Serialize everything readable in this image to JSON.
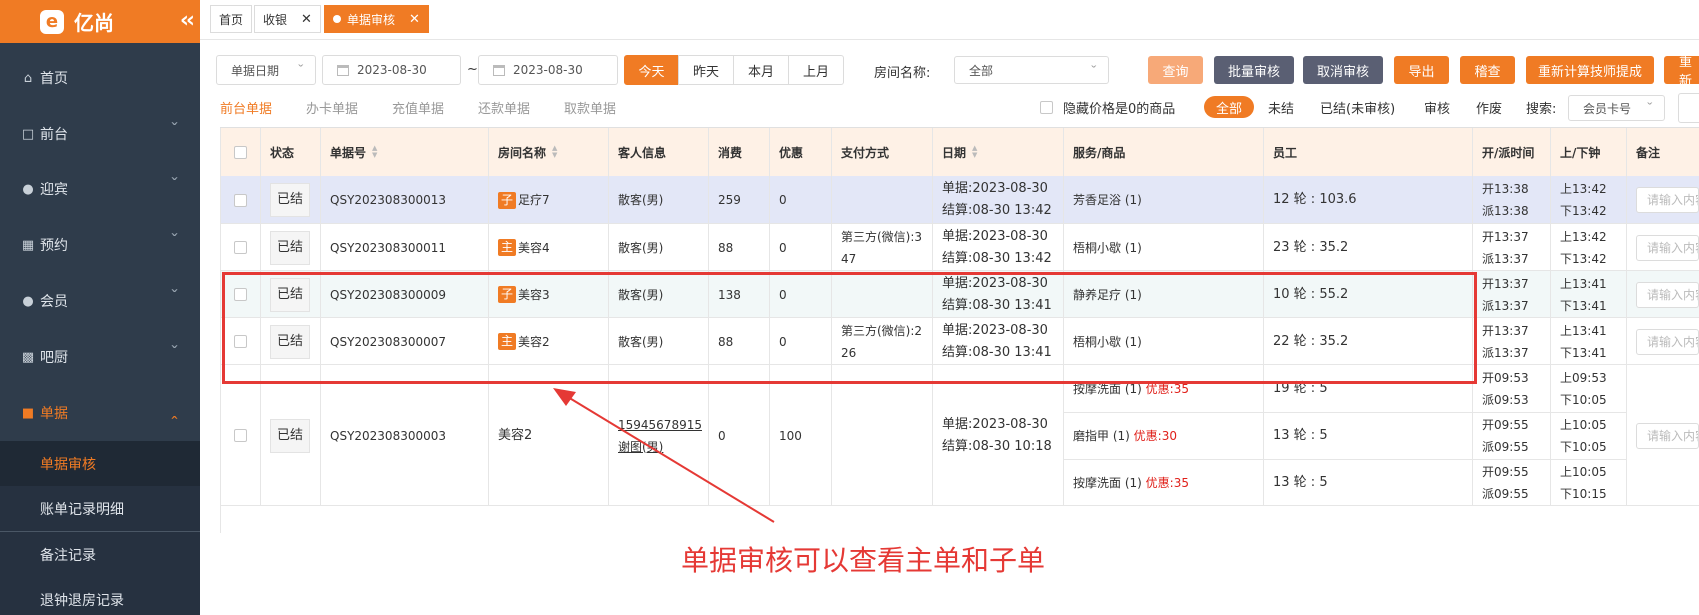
{
  "brand": {
    "name": "亿尚",
    "logo_mark": "e"
  },
  "colors": {
    "accent": "#f07b24",
    "sidebar": "#2f3c4b",
    "annotation": "#e53935",
    "highlight_row": "#e3e7f7"
  },
  "sidebar": {
    "items": [
      {
        "label": "首页",
        "icon": "home-icon"
      },
      {
        "label": "前台",
        "icon": "monitor-icon"
      },
      {
        "label": "迎宾",
        "icon": "user-plus-icon"
      },
      {
        "label": "预约",
        "icon": "calendar-icon"
      },
      {
        "label": "会员",
        "icon": "user-icon"
      },
      {
        "label": "吧厨",
        "icon": "coffee-icon"
      },
      {
        "label": "单据",
        "icon": "receipt-icon"
      }
    ],
    "sub_items": [
      "单据审核",
      "账单记录明细",
      "备注记录",
      "退钟退房记录"
    ]
  },
  "tabs": [
    {
      "label": "首页"
    },
    {
      "label": "收银"
    },
    {
      "label": "单据审核"
    }
  ],
  "toolbar": {
    "date_type": "单据日期",
    "date_from": "2023-08-30",
    "date_sep": "~",
    "date_to": "2023-08-30",
    "ranges": [
      "今天",
      "昨天",
      "本月",
      "上月"
    ],
    "room_label": "房间名称:",
    "room_value": "全部",
    "buttons": [
      "查询",
      "批量审核",
      "取消审核",
      "导出",
      "稽查",
      "重新计算技师提成",
      "重新"
    ]
  },
  "subtabs": [
    "前台单据",
    "办卡单据",
    "充值单据",
    "还款单据",
    "取款单据"
  ],
  "filters": {
    "hide_zero": "隐藏价格是0的商品",
    "statuses": [
      "全部",
      "未结",
      "已结(未审核)",
      "审核",
      "作废"
    ],
    "search_label": "搜索:",
    "search_type": "会员卡号"
  },
  "table": {
    "headers": [
      "状态",
      "单据号",
      "房间名称",
      "客人信息",
      "消费",
      "优惠",
      "支付方式",
      "日期",
      "服务/商品",
      "员工",
      "开/派时间",
      "上/下钟",
      "备注"
    ],
    "remark_placeholder": "请输入内容",
    "rows": [
      {
        "status": "已结",
        "no": "QSY202308300013",
        "tag": "子",
        "room": "足疗7",
        "guest": "散客(男)",
        "amount": "259",
        "discount": "0",
        "pay1": "",
        "pay2": "",
        "date1": "单据:2023-08-30",
        "date2": "结算:08-30 13:42",
        "service": "芳香足浴 (1)",
        "staff": "12 轮 : 103.6",
        "t1": "开13:38",
        "t2": "派13:38",
        "c1": "上13:42",
        "c2": "下13:42"
      },
      {
        "status": "已结",
        "no": "QSY202308300011",
        "tag": "主",
        "room": "美容4",
        "guest": "散客(男)",
        "amount": "88",
        "discount": "0",
        "pay1": "第三方(微信):3",
        "pay2": "47",
        "date1": "单据:2023-08-30",
        "date2": "结算:08-30 13:42",
        "service": "梧桐小歇 (1)",
        "staff": "23 轮 : 35.2",
        "t1": "开13:37",
        "t2": "派13:37",
        "c1": "上13:42",
        "c2": "下13:42"
      },
      {
        "status": "已结",
        "no": "QSY202308300009",
        "tag": "子",
        "room": "美容3",
        "guest": "散客(男)",
        "amount": "138",
        "discount": "0",
        "pay1": "",
        "pay2": "",
        "date1": "单据:2023-08-30",
        "date2": "结算:08-30 13:41",
        "service": "静养足疗 (1)",
        "staff": "10 轮 : 55.2",
        "t1": "开13:37",
        "t2": "派13:37",
        "c1": "上13:41",
        "c2": "下13:41"
      },
      {
        "status": "已结",
        "no": "QSY202308300007",
        "tag": "主",
        "room": "美容2",
        "guest": "散客(男)",
        "amount": "88",
        "discount": "0",
        "pay1": "第三方(微信):2",
        "pay2": "26",
        "date1": "单据:2023-08-30",
        "date2": "结算:08-30 13:41",
        "service": "梧桐小歇 (1)",
        "staff": "22 轮 : 35.2",
        "t1": "开13:37",
        "t2": "派13:37",
        "c1": "上13:41",
        "c2": "下13:41"
      }
    ],
    "multi": {
      "status": "已结",
      "no": "QSY202308300003",
      "room": "美容2",
      "phone": "15945678915",
      "guest": "谢图(男)",
      "amount": "0",
      "discount": "100",
      "date1": "单据:2023-08-30",
      "date2": "结算:08-30 10:18",
      "lines": [
        {
          "service": "按摩洗面 (1)",
          "disc": "优惠:35",
          "staff": "19 轮 : 5",
          "t1": "开09:53",
          "t2": "派09:53",
          "c1": "上09:53",
          "c2": "下10:05"
        },
        {
          "service": "磨指甲 (1)",
          "disc": "优惠:30",
          "staff": "13 轮 : 5",
          "t1": "开09:55",
          "t2": "派09:55",
          "c1": "上10:05",
          "c2": "下10:05"
        },
        {
          "service": "按摩洗面 (1)",
          "disc": "优惠:35",
          "staff": "13 轮 : 5",
          "t1": "开09:55",
          "t2": "派09:55",
          "c1": "上10:05",
          "c2": "下10:15"
        }
      ]
    }
  },
  "annotation": "单据审核可以查看主单和子单"
}
